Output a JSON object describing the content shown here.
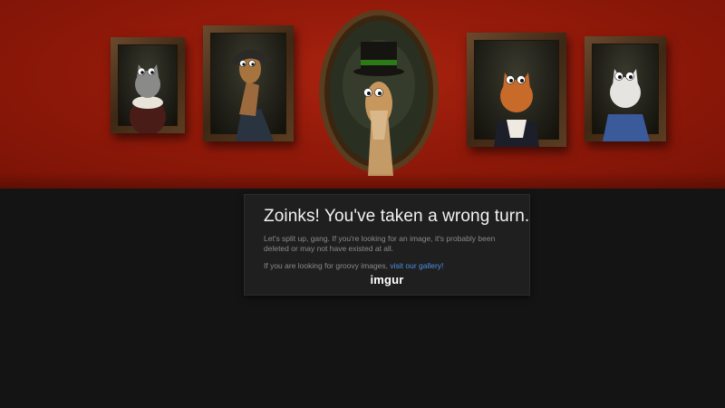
{
  "banner": {
    "portraits": [
      {
        "name": "cat-ruff-portrait",
        "subject": "grey cat in ruff collar"
      },
      {
        "name": "horse-hat-portrait",
        "subject": "horse in bicorne hat"
      },
      {
        "name": "giraffe-tophat-portrait",
        "subject": "giraffe in green top hat"
      },
      {
        "name": "orange-cat-portrait",
        "subject": "orange cat in cravat"
      },
      {
        "name": "white-cat-portrait",
        "subject": "white cat in blue coat"
      }
    ],
    "wall_color": "#931a0a"
  },
  "message": {
    "title": "Zoinks! You've taken a wrong turn.",
    "body": "Let's split up, gang. If you're looking for an image, it's probably been deleted or may not have existed at all.",
    "gallery_prefix": "If you are looking for groovy images, ",
    "gallery_link": "visit our gallery!",
    "link_color": "#4a90e2"
  },
  "logo": {
    "text": "imgur"
  }
}
